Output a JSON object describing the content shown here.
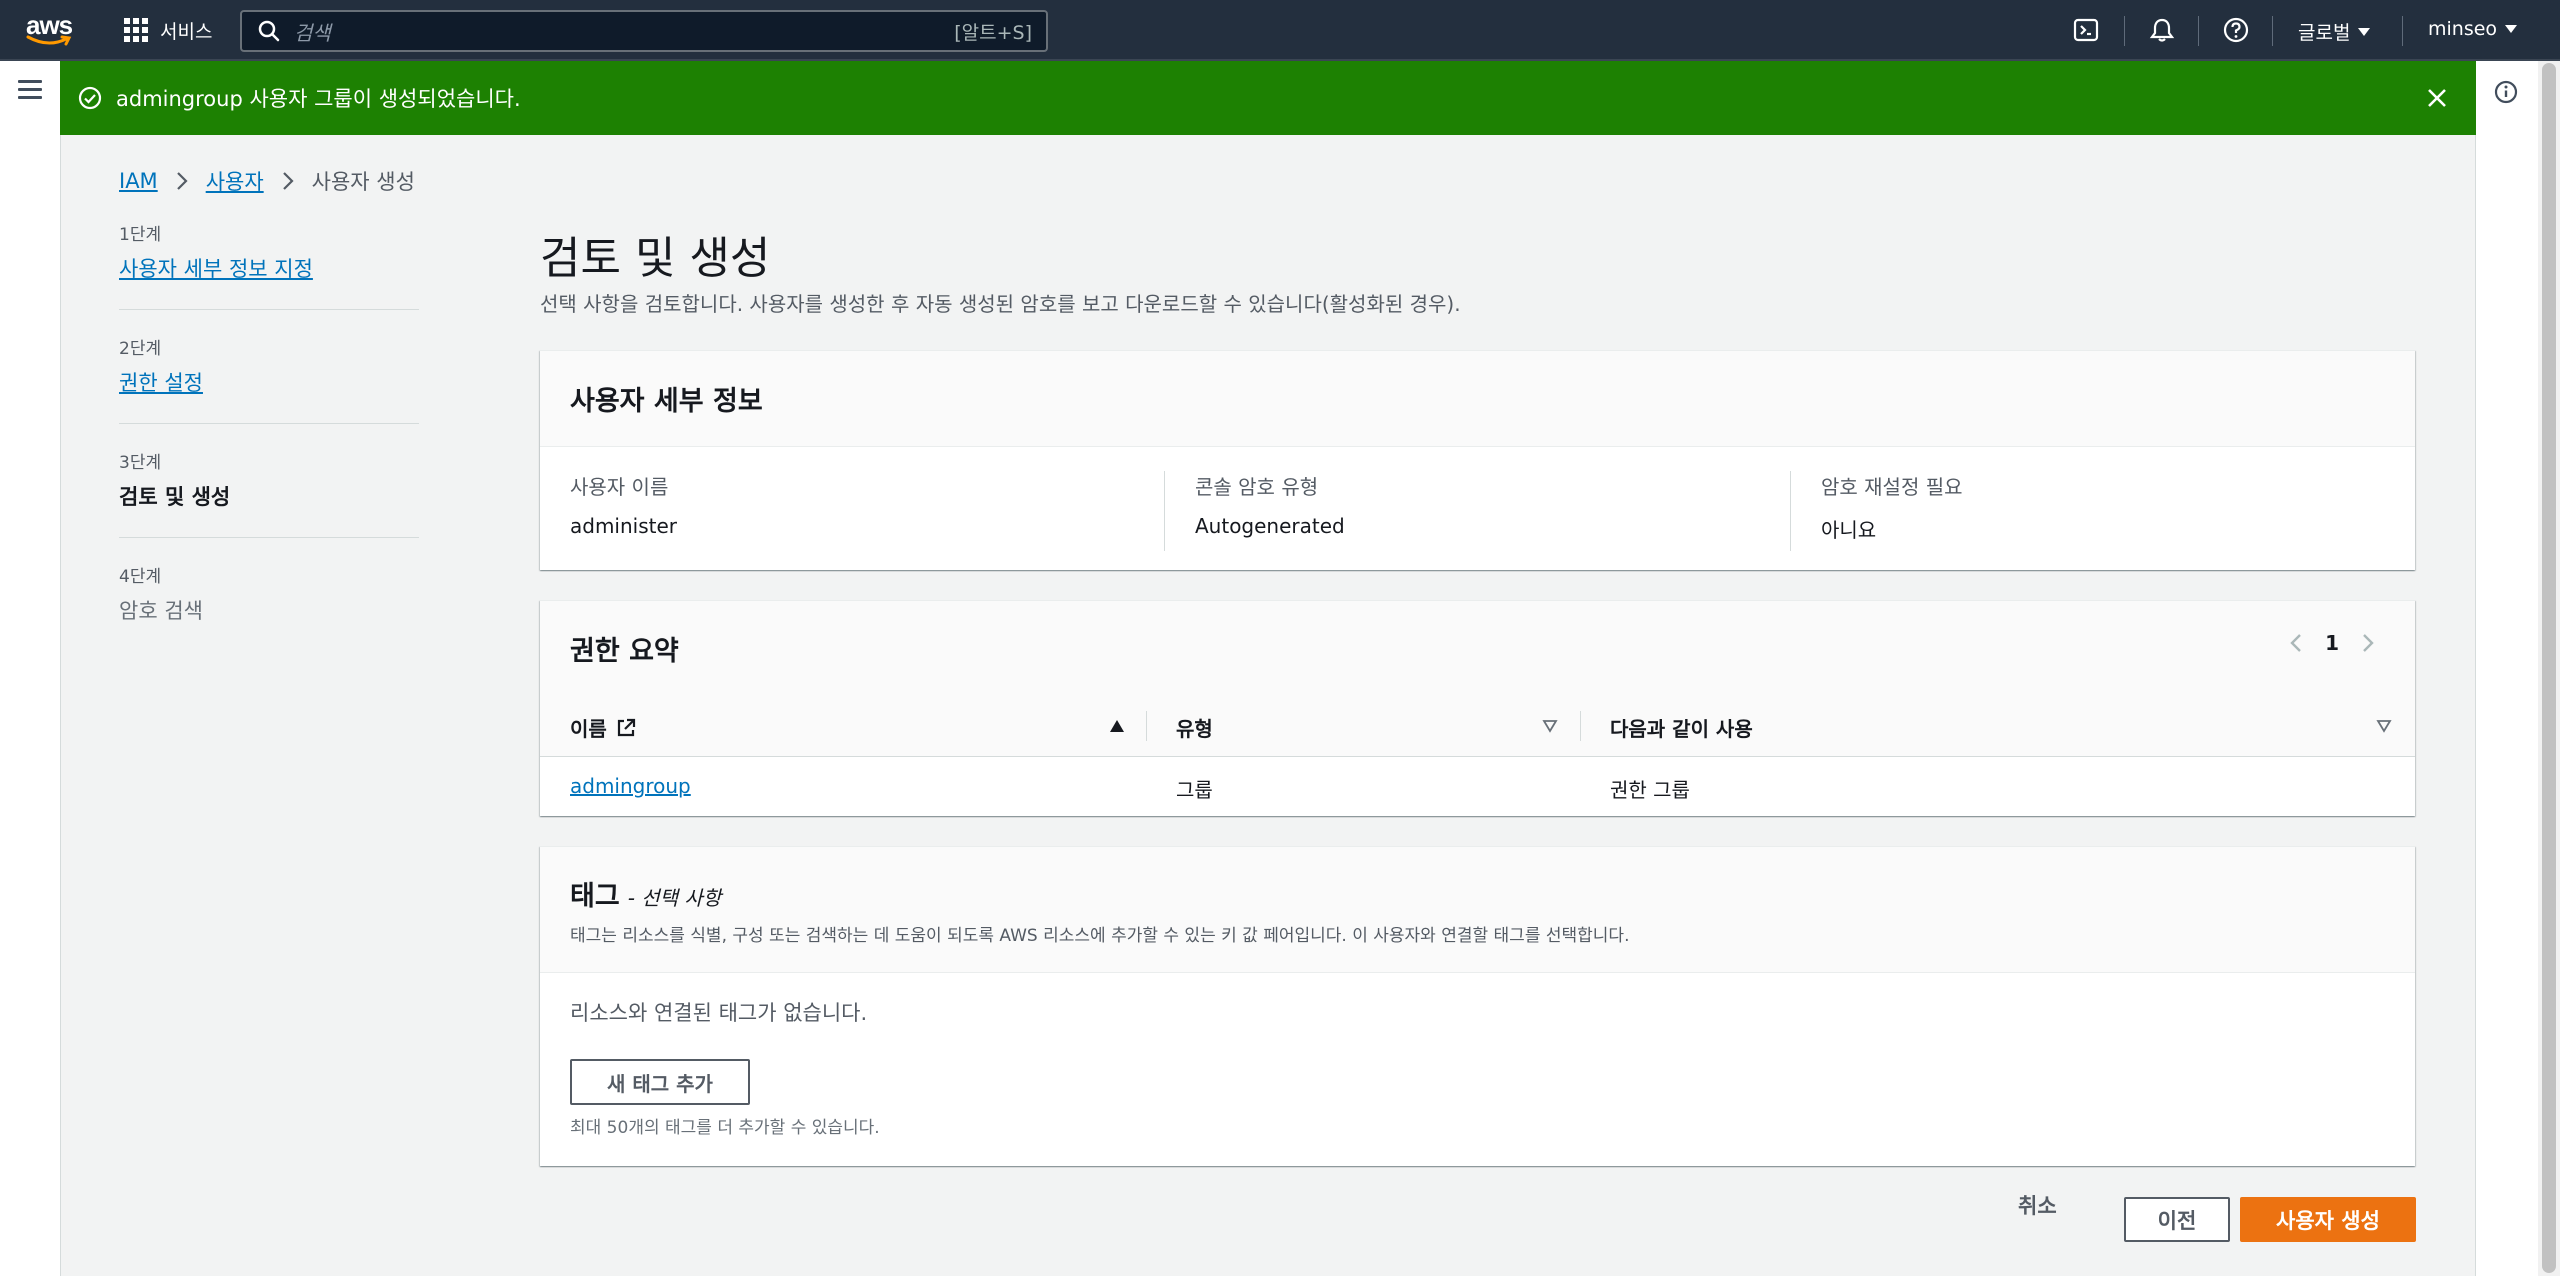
{
  "topnav": {
    "logo_text": "aws",
    "services_label": "서비스",
    "search_placeholder": "검색",
    "search_shortcut": "[알트+S]",
    "region_label": "글로벌",
    "user_label": "minseo"
  },
  "flash": {
    "message": "admingroup 사용자 그룹이 생성되었습니다.",
    "color": "#1d8102"
  },
  "breadcrumb": {
    "items": [
      "IAM",
      "사용자"
    ],
    "current": "사용자 생성"
  },
  "steps": [
    {
      "num": "1단계",
      "label": "사용자 세부 정보 지정"
    },
    {
      "num": "2단계",
      "label": "권한 설정"
    },
    {
      "num": "3단계",
      "label": "검토 및 생성"
    },
    {
      "num": "4단계",
      "label": "암호 검색"
    }
  ],
  "page": {
    "title": "검토 및 생성",
    "description": "선택 사항을 검토합니다. 사용자를 생성한 후 자동 생성된 암호를 보고 다운로드할 수 있습니다(활성화된 경우)."
  },
  "user_details": {
    "title": "사용자 세부 정보",
    "fields": [
      {
        "key": "사용자 이름",
        "value": "administer"
      },
      {
        "key": "콘솔 암호 유형",
        "value": "Autogenerated"
      },
      {
        "key": "암호 재설정 필요",
        "value": "아니요"
      }
    ]
  },
  "permissions": {
    "title": "권한 요약",
    "page": "1",
    "columns": [
      "이름",
      "유형",
      "다음과 같이 사용"
    ],
    "rows": [
      {
        "name": "admingroup",
        "type": "그룹",
        "used_as": "권한 그룹"
      }
    ]
  },
  "tags": {
    "title": "태그",
    "optional": "- 선택 사항",
    "description": "태그는 리소스를 식별, 구성 또는 검색하는 데 도움이 되도록 AWS 리소스에 추가할 수 있는 키 값 페어입니다. 이 사용자와 연결할 태그를 선택합니다.",
    "empty": "리소스와 연결된 태그가 없습니다.",
    "add_button": "새 태그 추가",
    "hint": "최대 50개의 태그를 더 추가할 수 있습니다."
  },
  "actions": {
    "cancel": "취소",
    "previous": "이전",
    "create": "사용자 생성",
    "primary_color": "#ec7211"
  }
}
